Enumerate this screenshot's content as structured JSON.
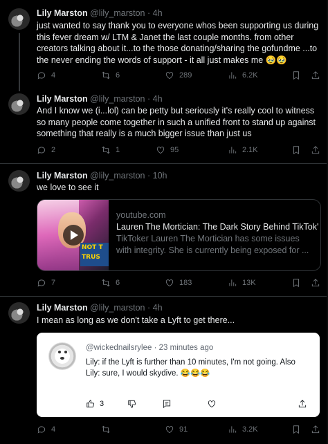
{
  "tweets": [
    {
      "name": "Lily Marston",
      "handle": "@lily_marston",
      "sep": "·",
      "time": "4h",
      "text": "just wanted to say thank you to everyone whos been supporting us during this fever dream w/ LTM & Janet the last couple months. from other creators talking about it...to the those donating/sharing the gofundme ...to the never ending the words of support - it all just makes me 🥹🥹",
      "replies": "4",
      "retweets": "6",
      "likes": "289",
      "views": "6.2K"
    },
    {
      "name": "Lily Marston",
      "handle": "@lily_marston",
      "sep": "·",
      "time": "4h",
      "text": "And I know we (i...lol) can be petty but seriously it's really cool to witness so many people come together in such a unified front to stand up against something that really is a much bigger issue than just us",
      "replies": "2",
      "retweets": "1",
      "likes": "95",
      "views": "2.1K"
    },
    {
      "name": "Lily Marston",
      "handle": "@lily_marston",
      "sep": "·",
      "time": "10h",
      "text": "we love to see it",
      "replies": "7",
      "retweets": "6",
      "likes": "183",
      "views": "13K",
      "card": {
        "domain": "youtube.com",
        "title": "Lauren The Mortician: The Dark Story Behind TikTok'",
        "description": "TikToker Lauren The Mortician has some issues with integrity. She is currently being exposed for ...",
        "thumb_text_1": "NOT T",
        "thumb_text_2": "TRUS"
      }
    },
    {
      "name": "Lily Marston",
      "handle": "@lily_marston",
      "sep": "·",
      "time": "4h",
      "text": "I mean as long as we don't take a Lyft to get there...",
      "replies": "4",
      "retweets": "",
      "likes": "91",
      "views": "3.2K",
      "embed": {
        "handle": "@wickednailsrylee",
        "sep": "·",
        "time": "23 minutes ago",
        "text": "Lily: if the Lyft is further than 10 minutes, I'm not going. Also Lily: sure, I would skydive. 😂😂😂",
        "likes": "3"
      }
    }
  ],
  "colors": {
    "background": "#000000",
    "text": "#e7e9ea",
    "muted": "#71767b",
    "divider": "#2f3336"
  },
  "icons": [
    "reply-icon",
    "retweet-icon",
    "like-icon",
    "views-icon",
    "bookmark-icon",
    "share-icon",
    "play-icon",
    "thumbs-up-icon",
    "thumbs-down-icon",
    "comment-icon",
    "heart-icon"
  ]
}
